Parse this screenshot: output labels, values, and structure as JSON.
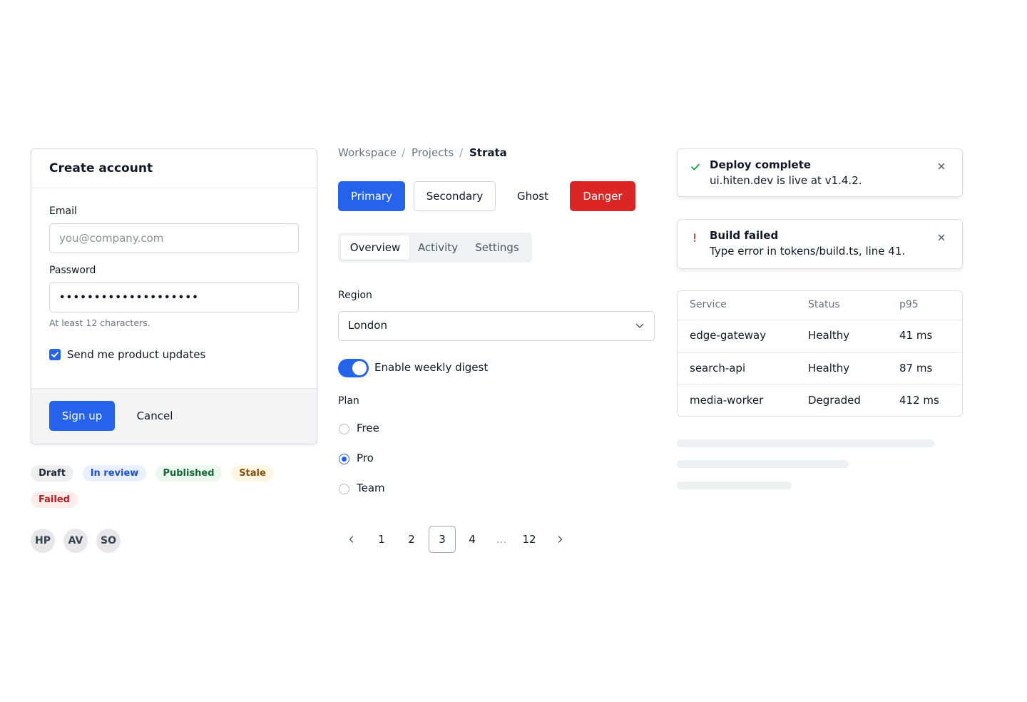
{
  "signup_card": {
    "title": "Create account",
    "email_label": "Email",
    "email_placeholder": "you@company.com",
    "email_value": "",
    "password_label": "Password",
    "password_value": "••••••••••••••••••••",
    "password_hint": "At least 12 characters.",
    "updates_label": "Send me product updates",
    "updates_checked": true,
    "submit_label": "Sign up",
    "cancel_label": "Cancel"
  },
  "badges": [
    {
      "label": "Draft",
      "bg": "#eeeeef",
      "fg": "#1f2937"
    },
    {
      "label": "In review",
      "bg": "#e8f0fe",
      "fg": "#1d4ed8"
    },
    {
      "label": "Published",
      "bg": "#e9f7ee",
      "fg": "#166534"
    },
    {
      "label": "Stale",
      "bg": "#fdf6e3",
      "fg": "#854d0e"
    },
    {
      "label": "Failed",
      "bg": "#fdecec",
      "fg": "#b91c1c"
    }
  ],
  "avatars": [
    "HP",
    "AV",
    "SO"
  ],
  "breadcrumb": {
    "items": [
      "Workspace",
      "Projects"
    ],
    "current": "Strata",
    "separator": "/"
  },
  "buttons": {
    "primary": "Primary",
    "secondary": "Secondary",
    "ghost": "Ghost",
    "danger": "Danger"
  },
  "tabs": {
    "items": [
      "Overview",
      "Activity",
      "Settings"
    ],
    "active": "Overview"
  },
  "region": {
    "label": "Region",
    "value": "London"
  },
  "digest_toggle": {
    "label": "Enable weekly digest",
    "on": true
  },
  "plan": {
    "label": "Plan",
    "options": [
      "Free",
      "Pro",
      "Team"
    ],
    "selected": "Pro"
  },
  "pagination": {
    "pages": [
      "1",
      "2",
      "3",
      "4"
    ],
    "ellipsis": "…",
    "last": "12",
    "current": "3"
  },
  "toasts": [
    {
      "title": "Deploy complete",
      "message": "ui.hiten.dev is live at v1.4.2.",
      "icon": "check-icon",
      "color": "#16a34a"
    },
    {
      "title": "Build failed",
      "message": "Type error in tokens/build.ts, line 41.",
      "icon": "exclamation-icon",
      "color": "#dc2626"
    }
  ],
  "services_table": {
    "headers": [
      "Service",
      "Status",
      "p95"
    ],
    "rows": [
      [
        "edge-gateway",
        "Healthy",
        "41 ms"
      ],
      [
        "search-api",
        "Healthy",
        "87 ms"
      ],
      [
        "media-worker",
        "Degraded",
        "412 ms"
      ]
    ]
  },
  "colors": {
    "accent": "#2563eb",
    "danger": "#dc2626"
  }
}
